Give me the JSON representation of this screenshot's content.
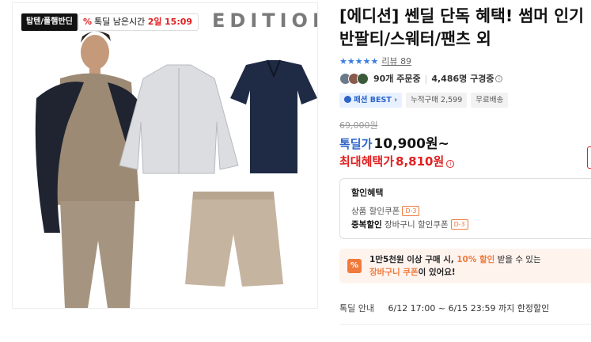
{
  "hero": {
    "badge_label": "탑텐/폴햄반딘",
    "timer_pct_icon": "%",
    "timer_prefix": "톡딜 남은시간",
    "timer_days": "2일",
    "timer_time": "15:09",
    "brand_mark": "EDITION"
  },
  "product": {
    "title": "[에디션] 쎈딜 단독 혜택! 썸머 인기 반팔티/스웨터/팬츠 외",
    "stars": "★★★★★",
    "review_label": "리뷰",
    "review_count": "89",
    "orders": "90개 주문중",
    "subscribers": "4,486명 구경중",
    "tags": [
      "패션 BEST",
      "누적구매 2,599",
      "무료배송"
    ],
    "original_price": "69,000원",
    "deal_label": "톡딜가",
    "deal_price": "10,900원~",
    "max_label": "최대혜택가",
    "max_price": "8,810원"
  },
  "discount": {
    "heading": "할인혜택",
    "row1_text": "상품 할인쿠폰",
    "row1_badge": "D-3",
    "row2_strong": "중복할인",
    "row2_text": "장바구니 할인쿠폰",
    "row2_badge": "D-3"
  },
  "coupon": {
    "icon": "%",
    "line1_a": "1만5천원 이상 구매 시,",
    "line1_b": "10% 할인",
    "line1_c": "받을 수 있는",
    "line2_a": "장바구니 쿠폰",
    "line2_b": "이 있어요!"
  },
  "notice": {
    "label": "톡딜 안내",
    "text": "6/12 17:00 ~ 6/15 23:59 까지 한정할인"
  },
  "colors": {
    "accent_blue": "#2c64c8",
    "accent_red": "#e02020",
    "accent_orange": "#f07a3c"
  }
}
